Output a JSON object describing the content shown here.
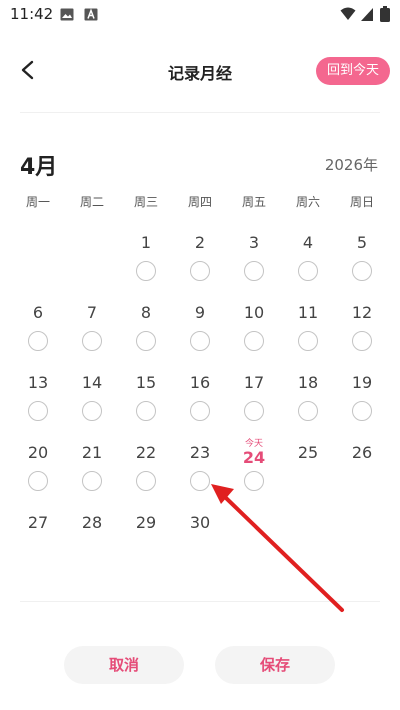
{
  "status_bar": {
    "time": "11:42"
  },
  "nav": {
    "title": "记录月经",
    "today_button": "回到今天"
  },
  "calendar": {
    "month": "4月",
    "year": "2026年",
    "weekdays": [
      "周一",
      "周二",
      "周三",
      "周四",
      "周五",
      "周六",
      "周日"
    ],
    "today_tag": "今天",
    "days": [
      {
        "n": "1",
        "circle": true
      },
      {
        "n": "2",
        "circle": true
      },
      {
        "n": "3",
        "circle": true
      },
      {
        "n": "4",
        "circle": true
      },
      {
        "n": "5",
        "circle": true
      },
      {
        "n": "6",
        "circle": true
      },
      {
        "n": "7",
        "circle": true
      },
      {
        "n": "8",
        "circle": true
      },
      {
        "n": "9",
        "circle": true
      },
      {
        "n": "10",
        "circle": true
      },
      {
        "n": "11",
        "circle": true
      },
      {
        "n": "12",
        "circle": true
      },
      {
        "n": "13",
        "circle": true
      },
      {
        "n": "14",
        "circle": true
      },
      {
        "n": "15",
        "circle": true
      },
      {
        "n": "16",
        "circle": true
      },
      {
        "n": "17",
        "circle": true
      },
      {
        "n": "18",
        "circle": true
      },
      {
        "n": "19",
        "circle": true
      },
      {
        "n": "20",
        "circle": true
      },
      {
        "n": "21",
        "circle": true
      },
      {
        "n": "22",
        "circle": true
      },
      {
        "n": "23",
        "circle": true
      },
      {
        "n": "24",
        "circle": true,
        "today": true
      },
      {
        "n": "25",
        "circle": false
      },
      {
        "n": "26",
        "circle": false
      },
      {
        "n": "27",
        "circle": false
      },
      {
        "n": "28",
        "circle": false
      },
      {
        "n": "29",
        "circle": false
      },
      {
        "n": "30",
        "circle": false
      }
    ]
  },
  "footer": {
    "cancel": "取消",
    "save": "保存"
  },
  "colors": {
    "accent": "#f4678f",
    "accent_text": "#e54c78",
    "annotation": "#e02020"
  }
}
